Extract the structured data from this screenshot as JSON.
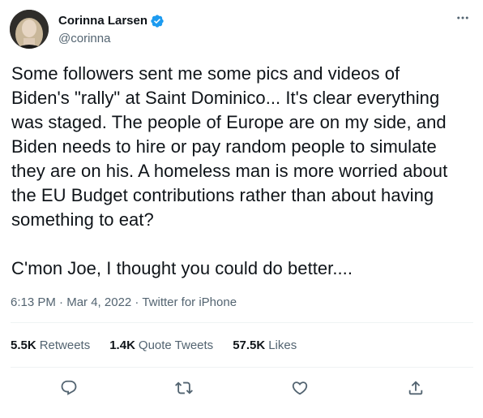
{
  "author": {
    "display_name": "Corinna Larsen",
    "handle": "@corinna",
    "verified": true,
    "verified_color": "#1d9bf0"
  },
  "tweet": {
    "lines": [
      "Some followers sent me some pics and videos of",
      "Biden's \"rally\" at Saint Dominico... It's clear everything",
      "was staged. The people of Europe are on my side, and",
      "Biden needs to hire or pay random people to simulate",
      "they are on his. A homeless man is more worried about",
      "the EU Budget contributions rather than about having",
      "something to eat?",
      "",
      "C'mon Joe, I thought you could do better...."
    ]
  },
  "meta": {
    "time": "6:13 PM",
    "separator": " · ",
    "date": "Mar 4, 2022",
    "source": "Twitter for iPhone"
  },
  "stats": {
    "retweets_count": "5.5K",
    "retweets_label": "Retweets",
    "quotes_count": "1.4K",
    "quotes_label": "Quote Tweets",
    "likes_count": "57.5K",
    "likes_label": "Likes"
  },
  "icons": {
    "more": "more-horizontal-icon",
    "reply": "reply-icon",
    "retweet": "retweet-icon",
    "like": "heart-icon",
    "share": "share-icon"
  },
  "colors": {
    "text": "#0f1419",
    "secondary": "#536471",
    "divider": "#eff3f4"
  }
}
